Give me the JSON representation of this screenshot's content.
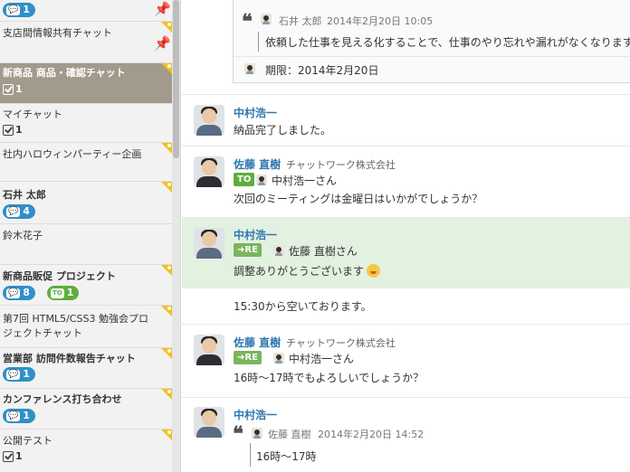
{
  "sidebar": {
    "rooms": [
      {
        "name": "",
        "badge": "1"
      },
      {
        "name": "支店間情報共有チャット"
      },
      {
        "name": "新商品 商品・確認チャット",
        "task_count": "1"
      },
      {
        "name": "マイチャット",
        "task_count": "1"
      },
      {
        "name": "社内ハロウィンパーティー企画"
      },
      {
        "name": "石井 太郎",
        "badge": "4"
      },
      {
        "name": "鈴木花子"
      },
      {
        "name": "新商品販促 プロジェクト",
        "badge": "8",
        "to_badge": "1"
      },
      {
        "name": "第7回 HTML5/CSS3 勉強会プロジェクトチャット"
      },
      {
        "name": "営業部 訪問件数報告チャット",
        "badge": "1"
      },
      {
        "name": "カンファレンス打ち合わせ",
        "badge": "1"
      },
      {
        "name": "公開テスト",
        "task_count": "1"
      }
    ]
  },
  "quote_top": {
    "author": "石井 太郎",
    "timestamp": "2014年2月20日 10:05",
    "text": "依頼した仕事を見える化することで、仕事のやり忘れや漏れがなくなります。",
    "deadline": "期限：2014年2月20日"
  },
  "messages": [
    {
      "user": "中村浩一",
      "text": "納品完了しました。"
    },
    {
      "user": "佐藤 直樹",
      "org": "チャットワーク株式会社",
      "to_label": "TO",
      "to_name": "中村浩一さん",
      "text": "次回のミーティングは金曜日はいかがでしょうか？"
    },
    {
      "user": "中村浩一",
      "re_label": "RE",
      "re_name": "佐藤 直樹さん",
      "text": "調整ありがとうございます",
      "followup": "15:30から空いております。"
    },
    {
      "user": "佐藤 直樹",
      "org": "チャットワーク株式会社",
      "re_label": "RE",
      "re_name": "中村浩一さん",
      "text": "16時～17時でもよろしいでしょうか？"
    },
    {
      "user": "中村浩一",
      "quote_author": "佐藤 直樹",
      "quote_time": "2014年2月20日 14:52",
      "quote_text": "16時～17時"
    }
  ],
  "colors": {
    "selected_room": "#a29a8c",
    "highlight": "#e3f1e0",
    "username": "#2f78b0",
    "badge": "#2f90c8",
    "to_tag": "#5fae3d"
  },
  "icons": {
    "pin": "pin-icon",
    "chat_bubble": "chat-bubble-icon",
    "task": "task-checkbox-icon",
    "quote": "quote-icon"
  }
}
